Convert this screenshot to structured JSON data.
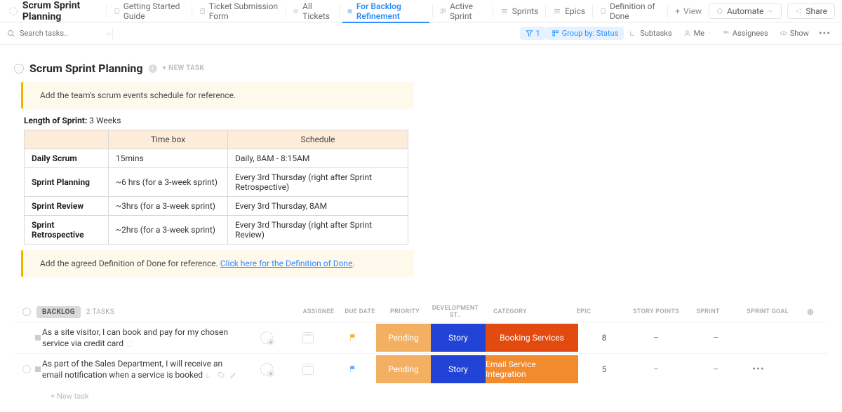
{
  "workspace_title": "Scrum Sprint Planning",
  "tabs": [
    {
      "label": "Getting Started Guide"
    },
    {
      "label": "Ticket Submission Form"
    },
    {
      "label": "All Tickets"
    },
    {
      "label": "For Backlog Refinement"
    },
    {
      "label": "Active Sprint"
    },
    {
      "label": "Sprints"
    },
    {
      "label": "Epics"
    },
    {
      "label": "Definition of Done"
    }
  ],
  "view_add": "View",
  "automate_label": "Automate",
  "share_label": "Share",
  "search_placeholder": "Search tasks..",
  "filter_count": "1",
  "filter_group": "Group by: Status",
  "filter_subtasks": "Subtasks",
  "filter_me": "Me",
  "filter_assignees": "Assignees",
  "filter_show": "Show",
  "list_title": "Scrum Sprint Planning",
  "new_task_ghost": "NEW TASK",
  "callout1": "Add the team's scrum events schedule for reference.",
  "sprint_length_label": "Length of Sprint:",
  "sprint_length_value": "3 Weeks",
  "events_table": {
    "headers": [
      "",
      "Time box",
      "Schedule"
    ],
    "rows": [
      {
        "name": "Daily Scrum",
        "timebox": "15mins",
        "schedule": "Daily, 8AM - 8:15AM"
      },
      {
        "name": "Sprint Planning",
        "timebox": "~6 hrs (for a 3-week sprint)",
        "schedule": "Every 3rd Thursday (right after Sprint Retrospective)"
      },
      {
        "name": "Sprint Review",
        "timebox": "~3hrs (for a 3-week sprint)",
        "schedule": "Every 3rd Thursday, 8AM"
      },
      {
        "name": "Sprint Retrospective",
        "timebox": "~2hrs (for a 3-week sprint)",
        "schedule": "Every 3rd Thursday (right after Sprint Review)"
      }
    ]
  },
  "callout2_text": "Add the agreed Definition of Done for reference. ",
  "callout2_link": "Click here for the Definition of Done",
  "backlog": {
    "group_label": "BACKLOG",
    "count_label": "2 TASKS",
    "columns": {
      "assignee": "ASSIGNEE",
      "due": "DUE DATE",
      "prio": "PRIORITY",
      "dev": "DEVELOPMENT ST..",
      "cat": "CATEGORY",
      "epic": "EPIC",
      "sp": "STORY POINTS",
      "sprint": "SPRINT",
      "goal": "SPRINT GOAL"
    },
    "tasks": [
      {
        "name": "As a site visitor, I can book and pay for my chosen service via credit card",
        "flag_color": "#f5b21a",
        "dev": "Pending",
        "cat": "Story",
        "epic": "Booking Services",
        "epic_class": "epic-booking",
        "sp": "8",
        "sprint": "–",
        "goal": "–",
        "show_actions": false,
        "show_inline_icons": false
      },
      {
        "name": "As part of the Sales Department, I will receive an email notification when a service is booked",
        "flag_color": "#6aa8f5",
        "dev": "Pending",
        "cat": "Story",
        "epic": "Email Service Integration",
        "epic_class": "epic-email",
        "sp": "5",
        "sprint": "–",
        "goal": "–",
        "show_actions": true,
        "show_inline_icons": true
      }
    ],
    "new_task_label": "New task"
  }
}
